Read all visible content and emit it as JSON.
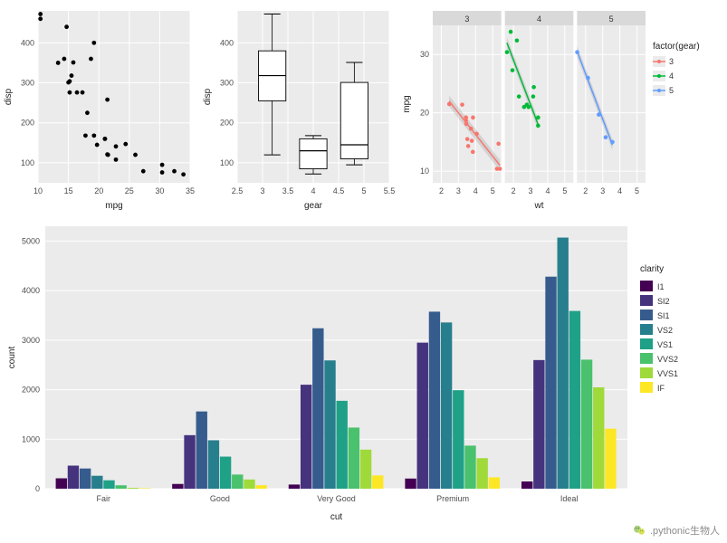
{
  "watermark": ".pythonic生物人",
  "chart_data": [
    {
      "type": "scatter",
      "id": "scatter-disp-mpg",
      "title": "",
      "xlabel": "mpg",
      "ylabel": "disp",
      "xlim": [
        10,
        35
      ],
      "ylim": [
        50,
        480
      ],
      "xticks": [
        10,
        15,
        20,
        25,
        30,
        35
      ],
      "yticks": [
        100,
        200,
        300,
        400
      ],
      "points": [
        {
          "x": 10.4,
          "y": 472
        },
        {
          "x": 10.4,
          "y": 460
        },
        {
          "x": 13.3,
          "y": 350
        },
        {
          "x": 14.3,
          "y": 360
        },
        {
          "x": 14.7,
          "y": 440
        },
        {
          "x": 15.0,
          "y": 301
        },
        {
          "x": 15.2,
          "y": 276
        },
        {
          "x": 15.2,
          "y": 304
        },
        {
          "x": 15.5,
          "y": 318
        },
        {
          "x": 15.8,
          "y": 351
        },
        {
          "x": 16.4,
          "y": 276
        },
        {
          "x": 17.3,
          "y": 276
        },
        {
          "x": 17.8,
          "y": 168
        },
        {
          "x": 18.1,
          "y": 225
        },
        {
          "x": 18.7,
          "y": 360
        },
        {
          "x": 19.2,
          "y": 168
        },
        {
          "x": 19.2,
          "y": 400
        },
        {
          "x": 19.7,
          "y": 145
        },
        {
          "x": 21.0,
          "y": 160
        },
        {
          "x": 21.0,
          "y": 160
        },
        {
          "x": 21.4,
          "y": 258
        },
        {
          "x": 21.4,
          "y": 121
        },
        {
          "x": 21.5,
          "y": 120
        },
        {
          "x": 22.8,
          "y": 108
        },
        {
          "x": 22.8,
          "y": 141
        },
        {
          "x": 24.4,
          "y": 147
        },
        {
          "x": 26.0,
          "y": 120
        },
        {
          "x": 27.3,
          "y": 79
        },
        {
          "x": 30.4,
          "y": 76
        },
        {
          "x": 30.4,
          "y": 95
        },
        {
          "x": 32.4,
          "y": 79
        },
        {
          "x": 33.9,
          "y": 71
        }
      ]
    },
    {
      "type": "boxplot",
      "id": "box-gear-disp",
      "title": "",
      "xlabel": "gear",
      "ylabel": "disp",
      "xticks_labels": [
        "2.5",
        "3",
        "3.5",
        "4",
        "4.5",
        "5",
        "5.5"
      ],
      "yticks": [
        100,
        200,
        300,
        400
      ],
      "ylim": [
        50,
        480
      ],
      "boxes": [
        {
          "x": "3",
          "min": 120,
          "q1": 255,
          "median": 318,
          "q3": 380,
          "max": 472
        },
        {
          "x": "4",
          "min": 72,
          "q1": 85,
          "median": 130,
          "q3": 160,
          "max": 168
        },
        {
          "x": "5",
          "min": 95,
          "q1": 110,
          "median": 145,
          "q3": 301,
          "max": 351
        }
      ]
    },
    {
      "type": "scatter",
      "id": "facet-mpg-wt-gear",
      "title": "",
      "xlabel": "wt",
      "ylabel": "mpg",
      "xlim": [
        1.5,
        5.5
      ],
      "ylim": [
        8,
        35
      ],
      "xticks": [
        2,
        3,
        4,
        5
      ],
      "yticks": [
        10,
        20,
        30
      ],
      "facets": [
        "3",
        "4",
        "5"
      ],
      "legend_title": "factor(gear)",
      "legend": [
        {
          "name": "3",
          "color": "#F8766D"
        },
        {
          "name": "4",
          "color": "#00BA38"
        },
        {
          "name": "5",
          "color": "#619CFF"
        }
      ],
      "series": [
        {
          "facet": "3",
          "color": "#F8766D",
          "points": [
            {
              "x": 2.46,
              "y": 21.5
            },
            {
              "x": 3.22,
              "y": 21.4
            },
            {
              "x": 3.44,
              "y": 19.2
            },
            {
              "x": 3.44,
              "y": 18.7
            },
            {
              "x": 3.46,
              "y": 18.1
            },
            {
              "x": 3.52,
              "y": 15.5
            },
            {
              "x": 3.57,
              "y": 14.3
            },
            {
              "x": 3.73,
              "y": 17.3
            },
            {
              "x": 3.78,
              "y": 15.2
            },
            {
              "x": 3.84,
              "y": 13.3
            },
            {
              "x": 3.85,
              "y": 19.2
            },
            {
              "x": 4.07,
              "y": 16.4
            },
            {
              "x": 5.25,
              "y": 10.4
            },
            {
              "x": 5.34,
              "y": 14.7
            },
            {
              "x": 5.42,
              "y": 10.4
            }
          ],
          "lm": {
            "x1": 2.46,
            "y1": 22,
            "x2": 5.42,
            "y2": 11
          }
        },
        {
          "facet": "4",
          "color": "#00BA38",
          "points": [
            {
              "x": 1.62,
              "y": 30.4
            },
            {
              "x": 1.84,
              "y": 33.9
            },
            {
              "x": 1.94,
              "y": 27.3
            },
            {
              "x": 2.2,
              "y": 32.4
            },
            {
              "x": 2.32,
              "y": 22.8
            },
            {
              "x": 2.62,
              "y": 21.0
            },
            {
              "x": 2.78,
              "y": 21.4
            },
            {
              "x": 2.88,
              "y": 21.0
            },
            {
              "x": 3.15,
              "y": 22.8
            },
            {
              "x": 3.19,
              "y": 24.4
            },
            {
              "x": 3.44,
              "y": 19.2
            },
            {
              "x": 3.44,
              "y": 17.8
            }
          ],
          "lm": {
            "x1": 1.62,
            "y1": 32,
            "x2": 3.44,
            "y2": 18
          }
        },
        {
          "facet": "5",
          "color": "#619CFF",
          "points": [
            {
              "x": 1.51,
              "y": 30.4
            },
            {
              "x": 2.14,
              "y": 26.0
            },
            {
              "x": 2.77,
              "y": 19.7
            },
            {
              "x": 3.17,
              "y": 15.8
            },
            {
              "x": 3.57,
              "y": 15.0
            }
          ],
          "lm": {
            "x1": 1.51,
            "y1": 30.5,
            "x2": 3.57,
            "y2": 14.5
          }
        }
      ]
    },
    {
      "type": "bar",
      "id": "bar-cut-clarity",
      "title": "",
      "xlabel": "cut",
      "ylabel": "count",
      "categories": [
        "Fair",
        "Good",
        "Very Good",
        "Premium",
        "Ideal"
      ],
      "yticks": [
        0,
        1000,
        2000,
        3000,
        4000,
        5000
      ],
      "ylim": [
        0,
        5300
      ],
      "legend_title": "clarity",
      "legend": [
        {
          "name": "I1",
          "color": "#440154"
        },
        {
          "name": "SI2",
          "color": "#46337E"
        },
        {
          "name": "SI1",
          "color": "#365C8D"
        },
        {
          "name": "VS2",
          "color": "#277F8E"
        },
        {
          "name": "VS1",
          "color": "#1FA187"
        },
        {
          "name": "VVS2",
          "color": "#4AC16D"
        },
        {
          "name": "VVS1",
          "color": "#9FDA3A"
        },
        {
          "name": "IF",
          "color": "#FDE725"
        }
      ],
      "series": [
        {
          "name": "I1",
          "color": "#440154",
          "values": [
            210,
            96,
            84,
            205,
            146
          ]
        },
        {
          "name": "SI2",
          "color": "#46337E",
          "values": [
            466,
            1081,
            2100,
            2949,
            2598
          ]
        },
        {
          "name": "SI1",
          "color": "#365C8D",
          "values": [
            408,
            1560,
            3240,
            3575,
            4282
          ]
        },
        {
          "name": "VS2",
          "color": "#277F8E",
          "values": [
            261,
            978,
            2591,
            3357,
            5071
          ]
        },
        {
          "name": "VS1",
          "color": "#1FA187",
          "values": [
            170,
            648,
            1775,
            1989,
            3589
          ]
        },
        {
          "name": "VVS2",
          "color": "#4AC16D",
          "values": [
            69,
            286,
            1235,
            870,
            2606
          ]
        },
        {
          "name": "VVS1",
          "color": "#9FDA3A",
          "values": [
            17,
            186,
            789,
            616,
            2047
          ]
        },
        {
          "name": "IF",
          "color": "#FDE725",
          "values": [
            9,
            71,
            268,
            230,
            1212
          ]
        }
      ]
    }
  ]
}
